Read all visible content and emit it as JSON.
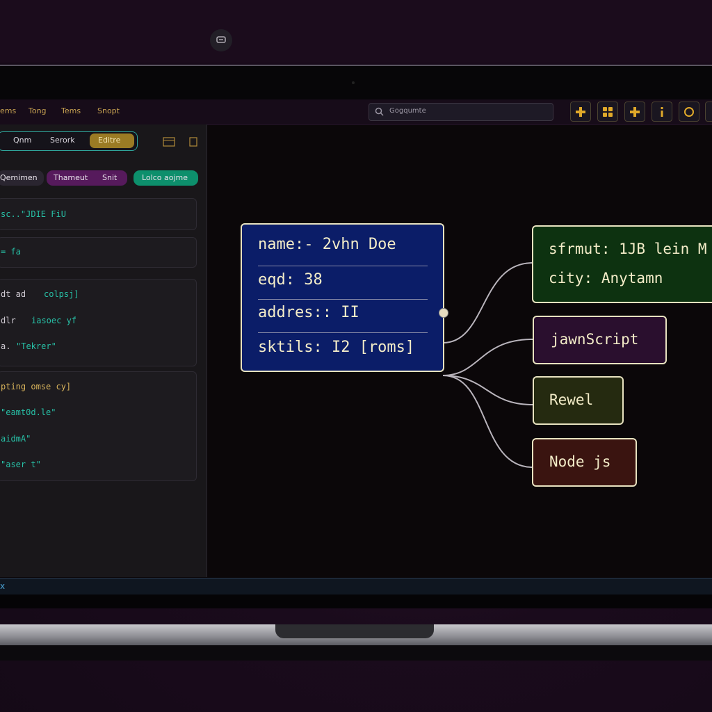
{
  "menu": [
    "ems",
    "Tong",
    "Tems",
    "Snopt"
  ],
  "search": {
    "placeholder": "Gogqumte"
  },
  "toolbar": {
    "icons": [
      "plus-icon",
      "grid-icon",
      "plus-icon",
      "info-icon",
      "circle-icon"
    ]
  },
  "left_panel": {
    "segments": [
      "Qnm",
      "Serork",
      "Editre"
    ],
    "active_segment": "Editre",
    "chips": [
      "Qemimen",
      "Thameut",
      "Snit",
      "Lolco aojme"
    ],
    "code_cards": [
      {
        "lines": [
          {
            "text": "sc..\"JDIE FiU",
            "color": "mixed"
          }
        ]
      },
      {
        "lines": [
          {
            "text": "= fa",
            "color": "mixed"
          }
        ]
      },
      {
        "lines": [
          {
            "key": "dt ad",
            "val": "colpsj]"
          },
          {
            "key": "dlr",
            "val": "iasoec yf"
          },
          {
            "key": "a.",
            "val": "\"Tekrer\""
          }
        ]
      },
      {
        "lines": [
          {
            "key": "pting omse cy]",
            "val": ""
          },
          {
            "key": "",
            "val": "\"eamt0d.le\""
          },
          {
            "key": "",
            "val": "aidmA\""
          },
          {
            "key": "",
            "val": "\"aser t\""
          }
        ]
      }
    ]
  },
  "bottom_bar": {
    "label": "x"
  },
  "graph": {
    "main_node": {
      "fields": [
        "name:- 2vhn Doe",
        "eqd: 38",
        "addres:: II",
        "sktils: I2 [roms]"
      ]
    },
    "children": [
      {
        "lines": [
          "sfrmut: 1JB lein M",
          "city: Anytamn"
        ],
        "color": "#0d3210"
      },
      {
        "lines": [
          "jawnScript"
        ],
        "color": "#2a0f2e"
      },
      {
        "lines": [
          "Rewel"
        ],
        "color": "#252a10"
      },
      {
        "lines": [
          "Node js"
        ],
        "color": "#3a1410"
      }
    ]
  },
  "colors": {
    "accent_teal": "#2fa59b",
    "accent_gold": "#c9a452",
    "main_node_bg": "#0b1d68"
  }
}
